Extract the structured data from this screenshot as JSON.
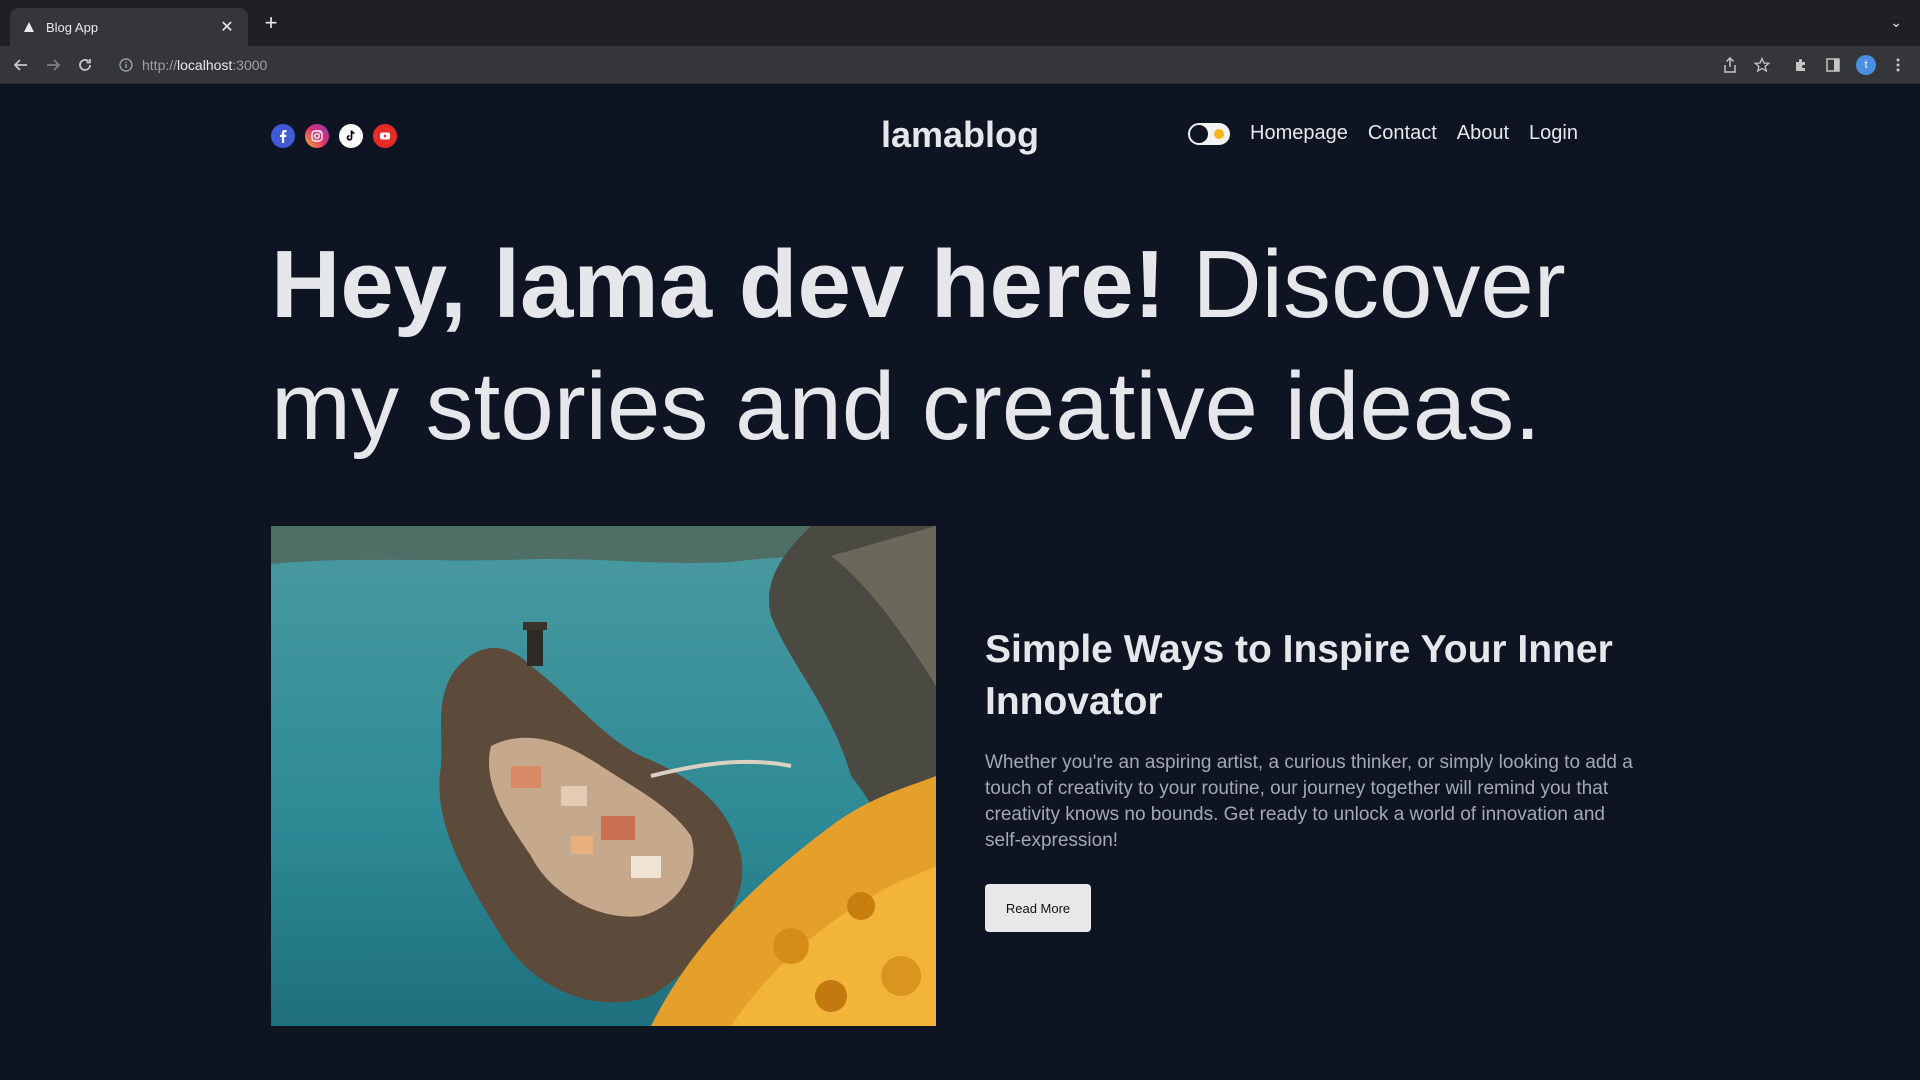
{
  "browser": {
    "tab_title": "Blog App",
    "url_prefix": "http://",
    "url_host": "localhost",
    "url_suffix": ":3000",
    "profile_initial": "t"
  },
  "header": {
    "socials": [
      "facebook-icon",
      "instagram-icon",
      "tiktok-icon",
      "youtube-icon"
    ],
    "logo": "lamablog",
    "nav": [
      "Homepage",
      "Contact",
      "About",
      "Login"
    ]
  },
  "hero": {
    "bold": "Hey, lama dev here!",
    "light": " Discover my stories and creative ideas."
  },
  "featured": {
    "image_alt": "coastal village on cliffs with yellow flowers",
    "title": "Simple Ways to Inspire Your Inner Innovator",
    "description": "Whether you're an aspiring artist, a curious thinker, or simply looking to add a touch of creativity to your routine, our journey together will remind you that creativity knows no bounds. Get ready to unlock a world of innovation and self-expression!",
    "button": "Read More"
  },
  "colors": {
    "background": "#0f1423",
    "text": "#e5e7eb",
    "muted": "#a3a8b4"
  }
}
